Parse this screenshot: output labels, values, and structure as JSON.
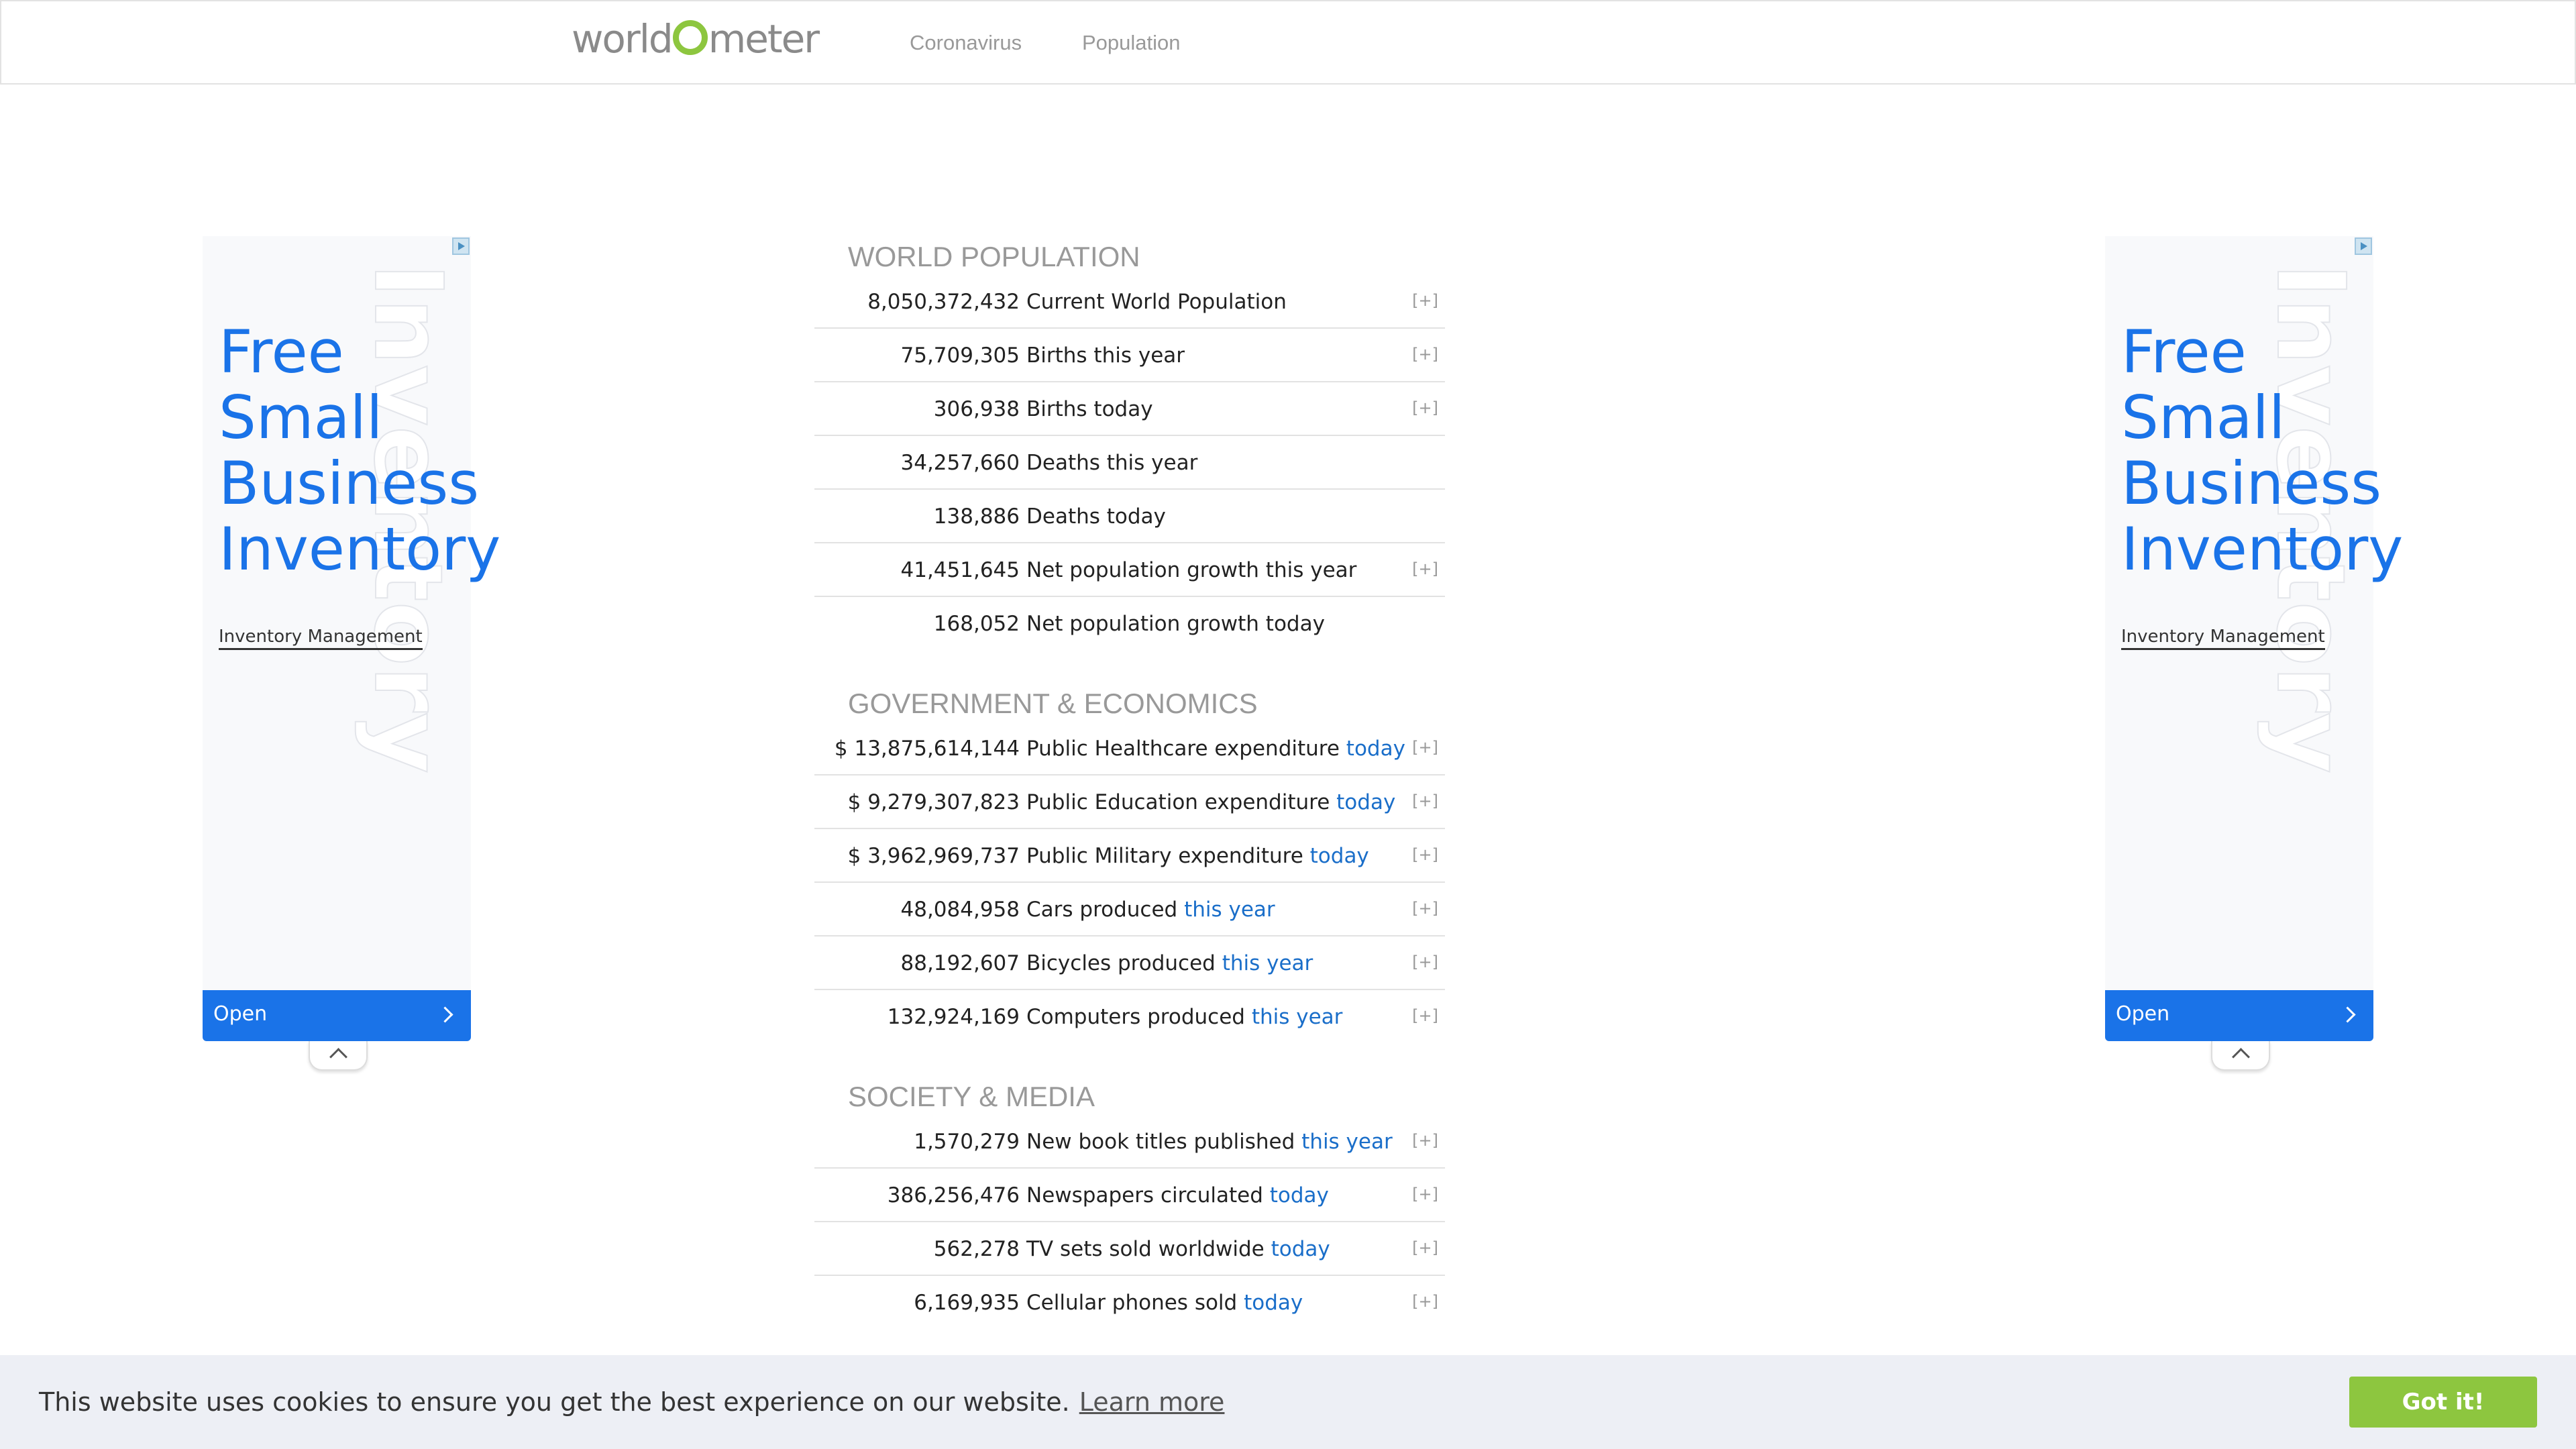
{
  "nav": {
    "logo_text": "worldometer",
    "links": [
      "Coronavirus",
      "Population"
    ]
  },
  "ad": {
    "headline_lines": [
      "Free",
      "Small",
      "Business",
      "Inventory"
    ],
    "link_text": "Inventory Management",
    "watermark": "Inventory",
    "open_label": "Open",
    "accent_color": "#1a73e8"
  },
  "sections": [
    {
      "title": "WORLD POPULATION",
      "rows": [
        {
          "value": "8,050,372,432",
          "label": "Current World Population",
          "link": "",
          "plus": "[+]"
        },
        {
          "value": "75,709,305",
          "label": "Births this year",
          "link": "",
          "plus": "[+]"
        },
        {
          "value": "306,938",
          "label": "Births today",
          "link": "",
          "plus": "[+]"
        },
        {
          "value": "34,257,660",
          "label": "Deaths this year",
          "link": "",
          "plus": ""
        },
        {
          "value": "138,886",
          "label": "Deaths today",
          "link": "",
          "plus": ""
        },
        {
          "value": "41,451,645",
          "label": "Net population growth this year",
          "link": "",
          "plus": "[+]"
        },
        {
          "value": "168,052",
          "label": "Net population growth today",
          "link": "",
          "plus": ""
        }
      ]
    },
    {
      "title": "GOVERNMENT & ECONOMICS",
      "rows": [
        {
          "value": "$ 13,875,614,144",
          "label": "Public Healthcare expenditure",
          "link": "today",
          "plus": "[+]"
        },
        {
          "value": "$ 9,279,307,823",
          "label": "Public Education expenditure",
          "link": "today",
          "plus": "[+]"
        },
        {
          "value": "$ 3,962,969,737",
          "label": "Public Military expenditure",
          "link": "today",
          "plus": "[+]"
        },
        {
          "value": "48,084,958",
          "label": "Cars produced",
          "link": "this year",
          "plus": "[+]"
        },
        {
          "value": "88,192,607",
          "label": "Bicycles produced",
          "link": "this year",
          "plus": "[+]"
        },
        {
          "value": "132,924,169",
          "label": "Computers produced",
          "link": "this year",
          "plus": "[+]"
        }
      ]
    },
    {
      "title": "SOCIETY & MEDIA",
      "rows": [
        {
          "value": "1,570,279",
          "label": "New book titles published",
          "link": "this year",
          "plus": "[+]"
        },
        {
          "value": "386,256,476",
          "label": "Newspapers circulated",
          "link": "today",
          "plus": "[+]"
        },
        {
          "value": "562,278",
          "label": "TV sets sold worldwide",
          "link": "today",
          "plus": "[+]"
        },
        {
          "value": "6,169,935",
          "label": "Cellular phones sold",
          "link": "today",
          "plus": "[+]"
        }
      ]
    }
  ],
  "cookie": {
    "message": "This website uses cookies to ensure you get the best experience on our website.",
    "learn_more": "Learn more",
    "button": "Got it!",
    "button_color": "#8dc63f"
  }
}
